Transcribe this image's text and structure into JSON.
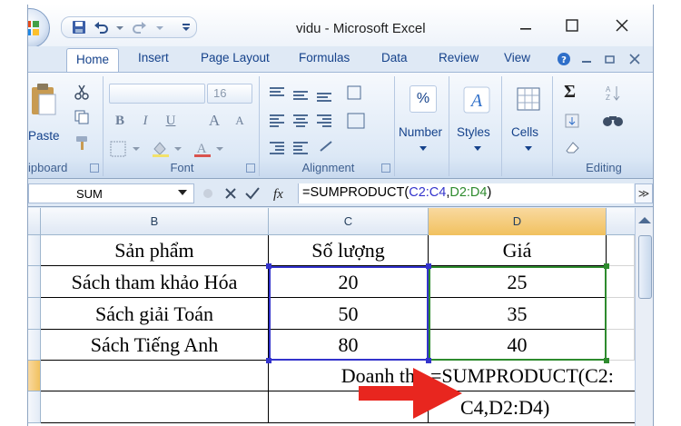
{
  "window": {
    "title": "vidu - Microsoft Excel",
    "minimize_glyph": "–",
    "maximize_glyph": "☐",
    "close_glyph": "✕"
  },
  "tabs": [
    {
      "label": "Home",
      "active": true
    },
    {
      "label": "Insert",
      "active": false
    },
    {
      "label": "Page Layout",
      "active": false
    },
    {
      "label": "Formulas",
      "active": false
    },
    {
      "label": "Data",
      "active": false
    },
    {
      "label": "Review",
      "active": false
    },
    {
      "label": "View",
      "active": false
    }
  ],
  "ribbon": {
    "clipboard": {
      "paste_label": "Paste",
      "group_label": "ipboard"
    },
    "font": {
      "font_size": "16",
      "group_label": "Font",
      "bold": "B",
      "italic": "I",
      "underline": "U",
      "grow": "A",
      "shrink": "A"
    },
    "alignment": {
      "group_label": "Alignment"
    },
    "number": {
      "label": "Number",
      "symbol": "%"
    },
    "styles": {
      "label": "Styles"
    },
    "cells": {
      "label": "Cells"
    },
    "editing": {
      "group_label": "Editing",
      "sum_symbol": "Σ"
    }
  },
  "formula_bar": {
    "name_box": "SUM",
    "fx": "fx",
    "formula_prefix": "=SUMPRODUCT(",
    "ref1": "C2:C4",
    "comma": ",",
    "ref2": "D2:D4",
    "formula_suffix": ")",
    "expand_glyph": "≫",
    "ref1_color": "#3333cc",
    "ref2_color": "#2e8b2e"
  },
  "columns": [
    "B",
    "C",
    "D"
  ],
  "selected_column": "D",
  "table": {
    "header": [
      "Sản phẩm",
      "Số lượng",
      "Giá"
    ],
    "rows": [
      [
        "Sách tham khảo Hóa",
        "20",
        "25"
      ],
      [
        "Sách giải Toán",
        "50",
        "35"
      ],
      [
        "Sách Tiếng Anh",
        "80",
        "40"
      ]
    ],
    "revenue_label": "Doanh thu",
    "formula_line1": "=SUMPRODUCT(C2:",
    "formula_line2": "C4,D2:D4)"
  },
  "colors": {
    "accent": "#15428b",
    "selected_header": "#f1c15f",
    "arrow": "#e8261f"
  }
}
